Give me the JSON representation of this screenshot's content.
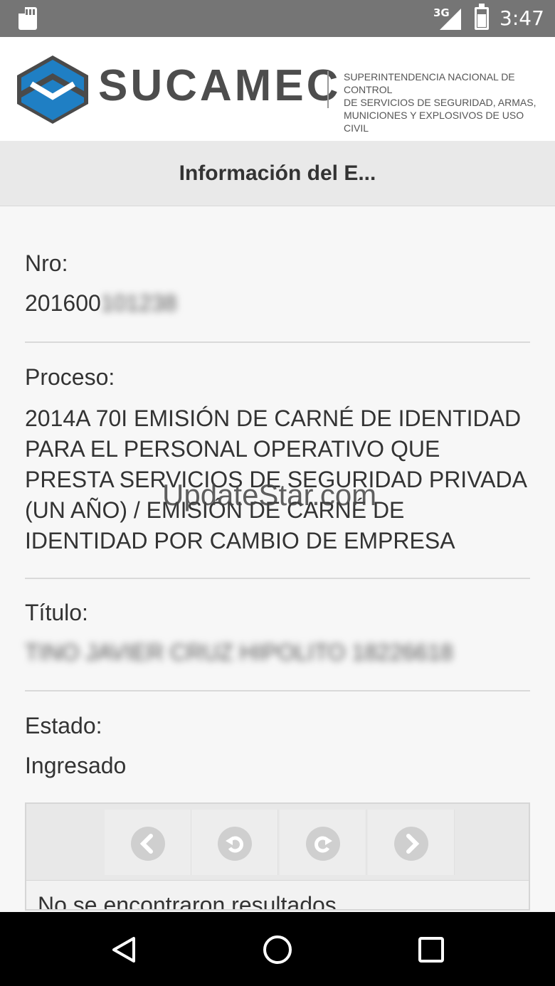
{
  "status_bar": {
    "network": "3G",
    "time": "3:47",
    "icons": [
      "sd-card-icon",
      "signal-icon",
      "battery-icon"
    ]
  },
  "brand": {
    "name": "SUCAMEC",
    "tagline_lines": [
      "SUPERINTENDENCIA NACIONAL DE CONTROL",
      "DE SERVICIOS DE SEGURIDAD, ARMAS,",
      "MUNICIONES Y EXPLOSIVOS DE USO CIVIL"
    ],
    "colors": {
      "primary_blue": "#1f7fc4",
      "dark_gray": "#4d4d4d"
    }
  },
  "page": {
    "title": "Información del E..."
  },
  "fields": {
    "nro": {
      "label": "Nro:",
      "value_visible": "201600",
      "value_blurred": "101238"
    },
    "proceso": {
      "label": "Proceso:",
      "value_lines": [
        "2014A 70I EMISIÓN DE CARNÉ DE IDENTIDAD",
        "PARA EL PERSONAL OPERATIVO QUE",
        "PRESTA SERVICIOS DE SEGURIDAD PRIVADA",
        "(UN AÑO) / EMISIÓN DE CARNÉ DE",
        "IDENTIDAD POR CAMBIO DE EMPRESA"
      ]
    },
    "titulo": {
      "label": "Título:",
      "value_blurred": "TINO JAVIER CRUZ HIPOLITO 18226618"
    },
    "estado": {
      "label": "Estado:",
      "value": "Ingresado"
    }
  },
  "watermark": "UpdateStar.com",
  "pager": {
    "buttons": [
      "first-page-icon",
      "previous-page-icon",
      "next-page-icon",
      "last-page-icon"
    ],
    "empty_message": "No se encontraron resultados"
  },
  "nav_bar": {
    "buttons": [
      "back-icon",
      "home-icon",
      "recents-icon"
    ]
  }
}
